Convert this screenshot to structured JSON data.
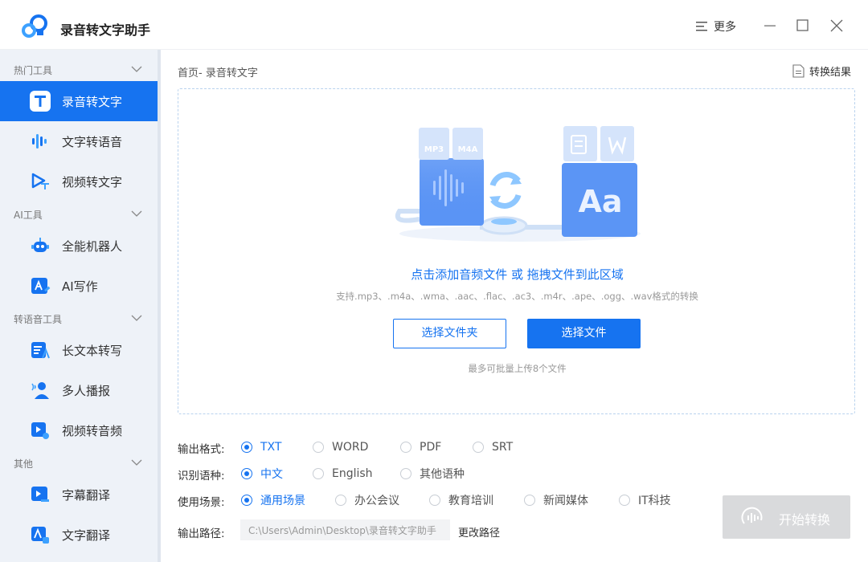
{
  "app": {
    "title": "录音转文字助手"
  },
  "window": {
    "more_label": "更多"
  },
  "sidebar": {
    "sections": [
      {
        "label": "热门工具"
      },
      {
        "label": "AI工具"
      },
      {
        "label": "转语音工具"
      },
      {
        "label": "其他"
      }
    ],
    "items": [
      {
        "label": "录音转文字",
        "icon": "text-t-icon",
        "active": true
      },
      {
        "label": "文字转语音",
        "icon": "voice-wave-icon"
      },
      {
        "label": "视频转文字",
        "icon": "video-text-icon"
      },
      {
        "label": "全能机器人",
        "icon": "robot-icon"
      },
      {
        "label": "AI写作",
        "icon": "ai-write-icon"
      },
      {
        "label": "长文本转写",
        "icon": "long-text-icon"
      },
      {
        "label": "多人播报",
        "icon": "multi-speaker-icon"
      },
      {
        "label": "视频转音频",
        "icon": "video-audio-icon"
      },
      {
        "label": "字幕翻译",
        "icon": "subtitle-translate-icon"
      },
      {
        "label": "文字翻译",
        "icon": "text-translate-icon"
      }
    ]
  },
  "main": {
    "breadcrumb": "首页- 录音转文字",
    "result_label": "转换结果",
    "dropzone": {
      "badges": [
        "MP3",
        "M4A"
      ],
      "title": "点击添加音频文件 或 拖拽文件到此区域",
      "subtitle": "支持.mp3、.m4a、.wma、.aac、.flac、.ac3、.m4r、.ape、.ogg、.wav格式的转换",
      "btn_folder": "选择文件夹",
      "btn_file": "选择文件",
      "note": "最多可批量上传8个文件"
    }
  },
  "options": {
    "format": {
      "label": "输出格式:",
      "options": [
        "TXT",
        "WORD",
        "PDF",
        "SRT"
      ],
      "selected": "TXT"
    },
    "language": {
      "label": "识别语种:",
      "options": [
        "中文",
        "English",
        "其他语种"
      ],
      "selected": "中文"
    },
    "scene": {
      "label": "使用场景:",
      "options": [
        "通用场景",
        "办公会议",
        "教育培训",
        "新闻媒体",
        "IT科技"
      ],
      "selected": "通用场景"
    },
    "path": {
      "label": "输出路径:",
      "value": "C:\\Users\\Admin\\Desktop\\录音转文字助手",
      "change_label": "更改路径"
    }
  },
  "start_button": {
    "label": "开始转换"
  },
  "colors": {
    "accent": "#1673f0",
    "sidebar_bg": "#eef2f8",
    "disabled": "#d9dadc"
  }
}
